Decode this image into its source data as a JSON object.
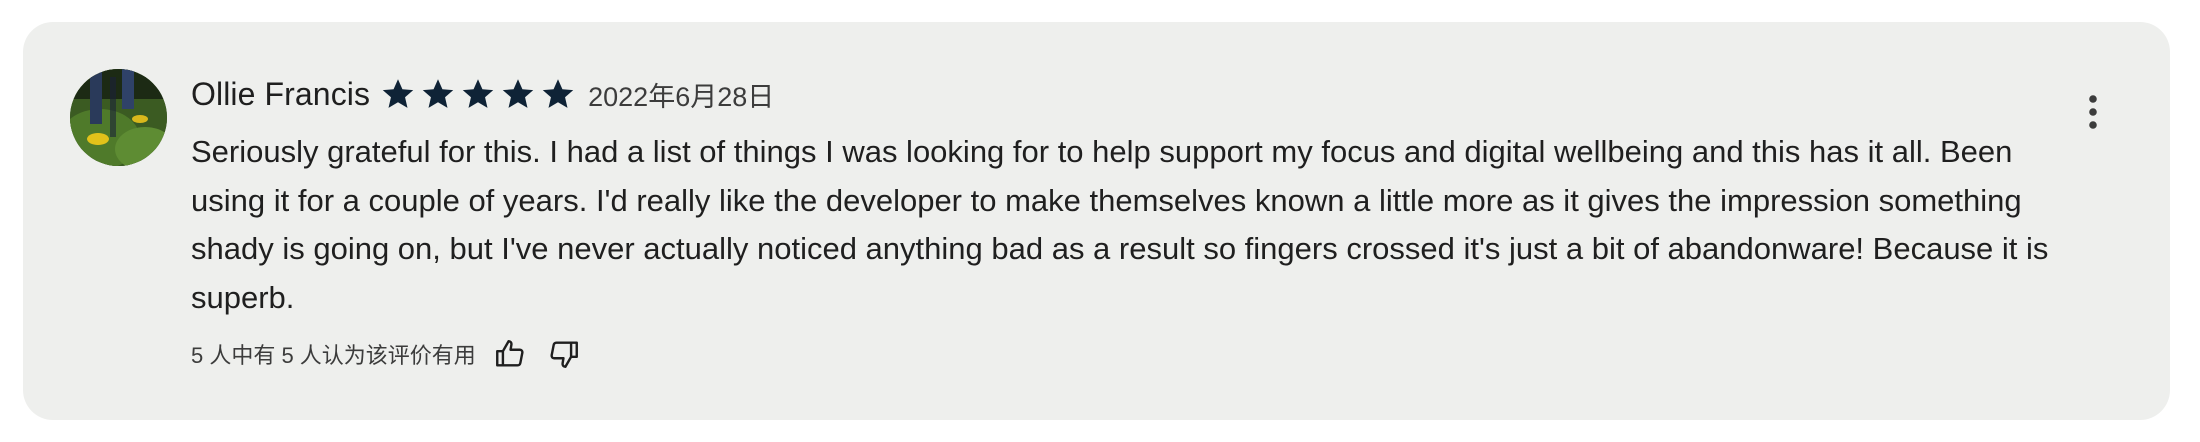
{
  "review": {
    "author": "Ollie Francis",
    "rating": 5,
    "rating_max": 5,
    "date": "2022年6月28日",
    "text": "Seriously grateful for this. I had a list of things I was looking for to help support my focus and digital wellbeing and this has it all. Been using it for a couple of years. I'd really like the developer to make themselves known a little more as it gives the impression something shady is going on, but I've never actually noticed anything bad as a result so fingers crossed it's just a bit of abandonware! Because it is superb.",
    "helpful_text": "5 人中有 5 人认为该评价有用"
  },
  "icons": {
    "star": "star-icon",
    "thumbs_up": "thumbs-up-icon",
    "thumbs_down": "thumbs-down-icon",
    "more": "more-vert-icon"
  },
  "colors": {
    "card_background": "#eeefed",
    "star": "#0f2336",
    "text": "#1f1f1f",
    "secondary_text": "#3c3c3c"
  }
}
